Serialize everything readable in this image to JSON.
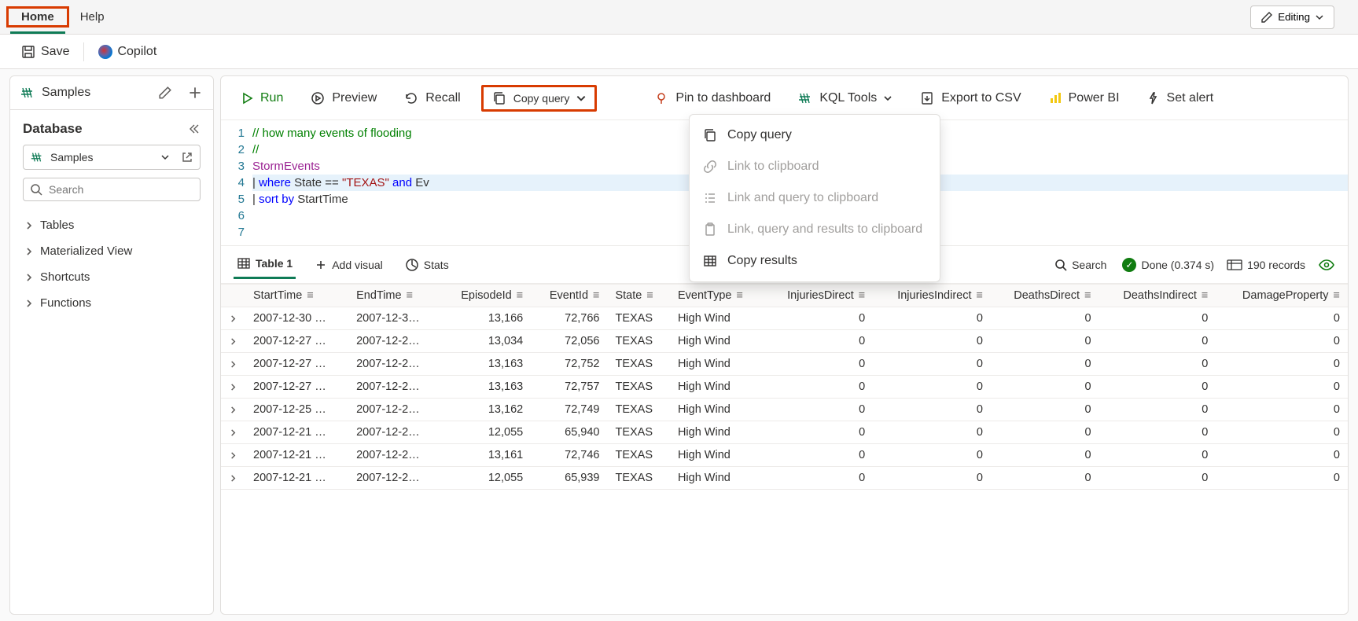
{
  "topTabs": {
    "home": "Home",
    "help": "Help"
  },
  "editingLabel": "Editing",
  "actionBar": {
    "save": "Save",
    "copilot": "Copilot"
  },
  "sidebar": {
    "title": "Samples",
    "databaseHeading": "Database",
    "selectValue": "Samples",
    "searchPlaceholder": "Search",
    "tree": [
      "Tables",
      "Materialized View",
      "Shortcuts",
      "Functions"
    ]
  },
  "toolbar": {
    "run": "Run",
    "preview": "Preview",
    "recall": "Recall",
    "copyQuery": "Copy query",
    "pin": "Pin to dashboard",
    "kqlTools": "KQL Tools",
    "export": "Export to CSV",
    "powerbi": "Power BI",
    "alert": "Set alert"
  },
  "dropdown": {
    "copyQuery": "Copy query",
    "linkClipboard": "Link to clipboard",
    "linkAndQuery": "Link and query to clipboard",
    "linkQueryResults": "Link, query and results to clipboard",
    "copyResults": "Copy results"
  },
  "editor": {
    "l1": "// how many events of flooding ",
    "l2": "//",
    "l3_ident": "StormEvents",
    "l4_a": "| ",
    "l4_kw": "where",
    "l4_b": " State ",
    "l4_op": "==",
    "l4_c": " ",
    "l4_str": "\"TEXAS\"",
    "l4_d": " ",
    "l4_kw2": "and",
    "l4_e": " Ev",
    "l5_a": "| ",
    "l5_kw": "sort by",
    "l5_b": " StartTime"
  },
  "resultsBar": {
    "table": "Table 1",
    "addVisual": "Add visual",
    "stats": "Stats",
    "search": "Search",
    "done": "Done (0.374 s)",
    "records": "190 records"
  },
  "columns": [
    "StartTime",
    "EndTime",
    "EpisodeId",
    "EventId",
    "State",
    "EventType",
    "InjuriesDirect",
    "InjuriesIndirect",
    "DeathsDirect",
    "DeathsIndirect",
    "DamageProperty"
  ],
  "rows": [
    {
      "StartTime": "2007-12-30 …",
      "EndTime": "2007-12-3…",
      "EpisodeId": "13,166",
      "EventId": "72,766",
      "State": "TEXAS",
      "EventType": "High Wind",
      "InjuriesDirect": "0",
      "InjuriesIndirect": "0",
      "DeathsDirect": "0",
      "DeathsIndirect": "0",
      "DamageProperty": "0"
    },
    {
      "StartTime": "2007-12-27 …",
      "EndTime": "2007-12-2…",
      "EpisodeId": "13,034",
      "EventId": "72,056",
      "State": "TEXAS",
      "EventType": "High Wind",
      "InjuriesDirect": "0",
      "InjuriesIndirect": "0",
      "DeathsDirect": "0",
      "DeathsIndirect": "0",
      "DamageProperty": "0"
    },
    {
      "StartTime": "2007-12-27 …",
      "EndTime": "2007-12-2…",
      "EpisodeId": "13,163",
      "EventId": "72,752",
      "State": "TEXAS",
      "EventType": "High Wind",
      "InjuriesDirect": "0",
      "InjuriesIndirect": "0",
      "DeathsDirect": "0",
      "DeathsIndirect": "0",
      "DamageProperty": "0"
    },
    {
      "StartTime": "2007-12-27 …",
      "EndTime": "2007-12-2…",
      "EpisodeId": "13,163",
      "EventId": "72,757",
      "State": "TEXAS",
      "EventType": "High Wind",
      "InjuriesDirect": "0",
      "InjuriesIndirect": "0",
      "DeathsDirect": "0",
      "DeathsIndirect": "0",
      "DamageProperty": "0"
    },
    {
      "StartTime": "2007-12-25 …",
      "EndTime": "2007-12-2…",
      "EpisodeId": "13,162",
      "EventId": "72,749",
      "State": "TEXAS",
      "EventType": "High Wind",
      "InjuriesDirect": "0",
      "InjuriesIndirect": "0",
      "DeathsDirect": "0",
      "DeathsIndirect": "0",
      "DamageProperty": "0"
    },
    {
      "StartTime": "2007-12-21 …",
      "EndTime": "2007-12-2…",
      "EpisodeId": "12,055",
      "EventId": "65,940",
      "State": "TEXAS",
      "EventType": "High Wind",
      "InjuriesDirect": "0",
      "InjuriesIndirect": "0",
      "DeathsDirect": "0",
      "DeathsIndirect": "0",
      "DamageProperty": "0"
    },
    {
      "StartTime": "2007-12-21 …",
      "EndTime": "2007-12-2…",
      "EpisodeId": "13,161",
      "EventId": "72,746",
      "State": "TEXAS",
      "EventType": "High Wind",
      "InjuriesDirect": "0",
      "InjuriesIndirect": "0",
      "DeathsDirect": "0",
      "DeathsIndirect": "0",
      "DamageProperty": "0"
    },
    {
      "StartTime": "2007-12-21 …",
      "EndTime": "2007-12-2…",
      "EpisodeId": "12,055",
      "EventId": "65,939",
      "State": "TEXAS",
      "EventType": "High Wind",
      "InjuriesDirect": "0",
      "InjuriesIndirect": "0",
      "DeathsDirect": "0",
      "DeathsIndirect": "0",
      "DamageProperty": "0"
    }
  ]
}
